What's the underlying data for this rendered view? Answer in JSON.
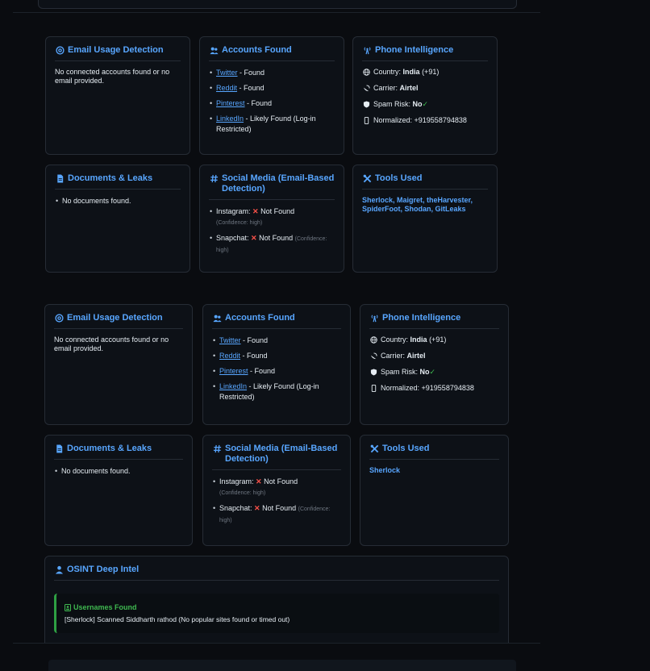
{
  "sets": [
    {
      "email": {
        "title": "Email Usage Detection",
        "text": "No connected accounts found or no email provided."
      },
      "accounts": {
        "title": "Accounts Found",
        "items": [
          {
            "link": "Twitter",
            "status": "- Found"
          },
          {
            "link": "Reddit",
            "status": "- Found"
          },
          {
            "link": "Pinterest",
            "status": "- Found"
          },
          {
            "link": "LinkedIn",
            "status": "- Likely Found (Log-in Restricted)"
          }
        ]
      },
      "phone": {
        "title": "Phone Intelligence",
        "country_label": "Country:",
        "country": "India",
        "country_code": "(+91)",
        "carrier_label": "Carrier:",
        "carrier": "Airtel",
        "spam_label": "Spam Risk:",
        "spam": "No",
        "spam_mark": "✓",
        "normalized_label": "Normalized:",
        "normalized": "+919558794838"
      },
      "docs": {
        "title": "Documents & Leaks",
        "items": [
          "No documents found."
        ]
      },
      "social": {
        "title": "Social Media (Email-Based Detection)",
        "items": [
          {
            "platform": "Instagram:",
            "mark": "✕",
            "status": "Not Found",
            "confidence": "(Confidence: high)"
          },
          {
            "platform": "Snapchat:",
            "mark": "✕",
            "status": "Not Found",
            "confidence": "(Confidence: high)"
          }
        ]
      },
      "tools": {
        "title": "Tools Used",
        "text": "Sherlock, Maigret, theHarvester, SpiderFoot, Shodan, GitLeaks"
      }
    },
    {
      "email": {
        "title": "Email Usage Detection",
        "text": "No connected accounts found or no email provided."
      },
      "accounts": {
        "title": "Accounts Found",
        "items": [
          {
            "link": "Twitter",
            "status": "- Found"
          },
          {
            "link": "Reddit",
            "status": "- Found"
          },
          {
            "link": "Pinterest",
            "status": "- Found"
          },
          {
            "link": "LinkedIn",
            "status": "- Likely Found (Log-in Restricted)"
          }
        ]
      },
      "phone": {
        "title": "Phone Intelligence",
        "country_label": "Country:",
        "country": "India",
        "country_code": "(+91)",
        "carrier_label": "Carrier:",
        "carrier": "Airtel",
        "spam_label": "Spam Risk:",
        "spam": "No",
        "spam_mark": "✓",
        "normalized_label": "Normalized:",
        "normalized": "+919558794838"
      },
      "docs": {
        "title": "Documents & Leaks",
        "items": [
          "No documents found."
        ]
      },
      "social": {
        "title": "Social Media (Email-Based Detection)",
        "items": [
          {
            "platform": "Instagram:",
            "mark": "✕",
            "status": "Not Found",
            "confidence": "(Confidence: high)"
          },
          {
            "platform": "Snapchat:",
            "mark": "✕",
            "status": "Not Found",
            "confidence": "(Confidence: high)"
          }
        ]
      },
      "tools": {
        "title": "Tools Used",
        "text": "Sherlock"
      }
    }
  ],
  "osint": {
    "title": "OSINT Deep Intel",
    "usernames_title": "Usernames Found",
    "usernames_text": "[Sherlock] Scanned Siddharth rathod (No popular sites found or timed out)"
  },
  "colors": {
    "accent": "#58a6ff",
    "success": "#3fb950",
    "danger": "#f85149",
    "card_bg": "#0d1117",
    "border": "#262c35"
  }
}
